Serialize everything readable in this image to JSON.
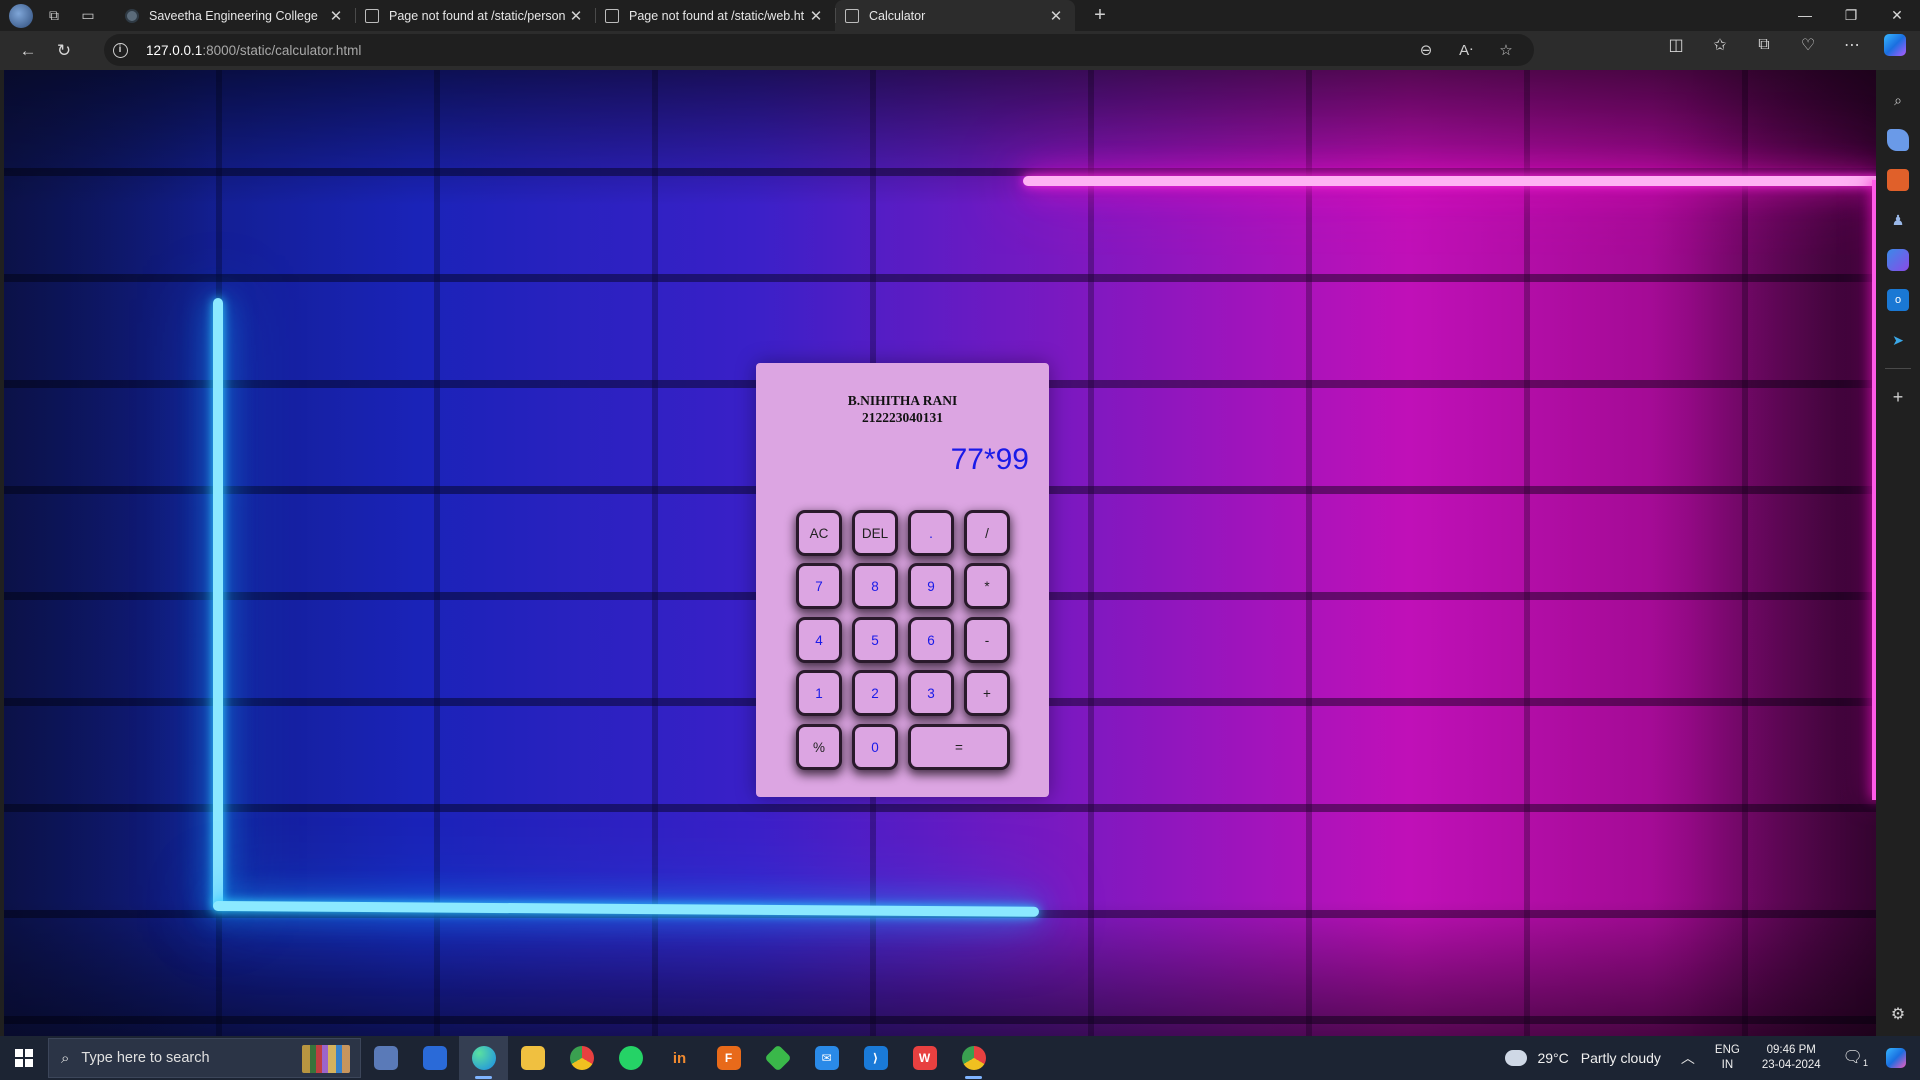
{
  "browser": {
    "tabs": [
      {
        "title": "Saveetha Engineering College",
        "active": false
      },
      {
        "title": "Page not found at /static/person",
        "active": false
      },
      {
        "title": "Page not found at /static/web.ht",
        "active": false
      },
      {
        "title": "Calculator",
        "active": true
      }
    ],
    "url_host": "127.0.0.1",
    "url_rest": ":8000/static/calculator.html"
  },
  "calculator": {
    "name": "B.NIHITHA RANI",
    "roll_no": "212223040131",
    "display": "77*99",
    "keys": {
      "ac": "AC",
      "del": "DEL",
      "dot": ".",
      "divide": "/",
      "seven": "7",
      "eight": "8",
      "nine": "9",
      "multiply": "*",
      "four": "4",
      "five": "5",
      "six": "6",
      "minus": "-",
      "one": "1",
      "two": "2",
      "three": "3",
      "plus": "+",
      "percent": "%",
      "zero": "0",
      "equals": "="
    }
  },
  "taskbar": {
    "search_placeholder": "Type here to search",
    "weather_temp": "29°C",
    "weather_text": "Partly cloudy",
    "lang_line1": "ENG",
    "lang_line2": "IN",
    "time": "09:46 PM",
    "date": "23-04-2024",
    "notification_count": "1"
  },
  "colors": {
    "calculator_bg": "#dca5e2",
    "display_text": "#1a1ae8",
    "neon_blue": "#2fd0ff",
    "neon_pink": "#ff10d0"
  }
}
